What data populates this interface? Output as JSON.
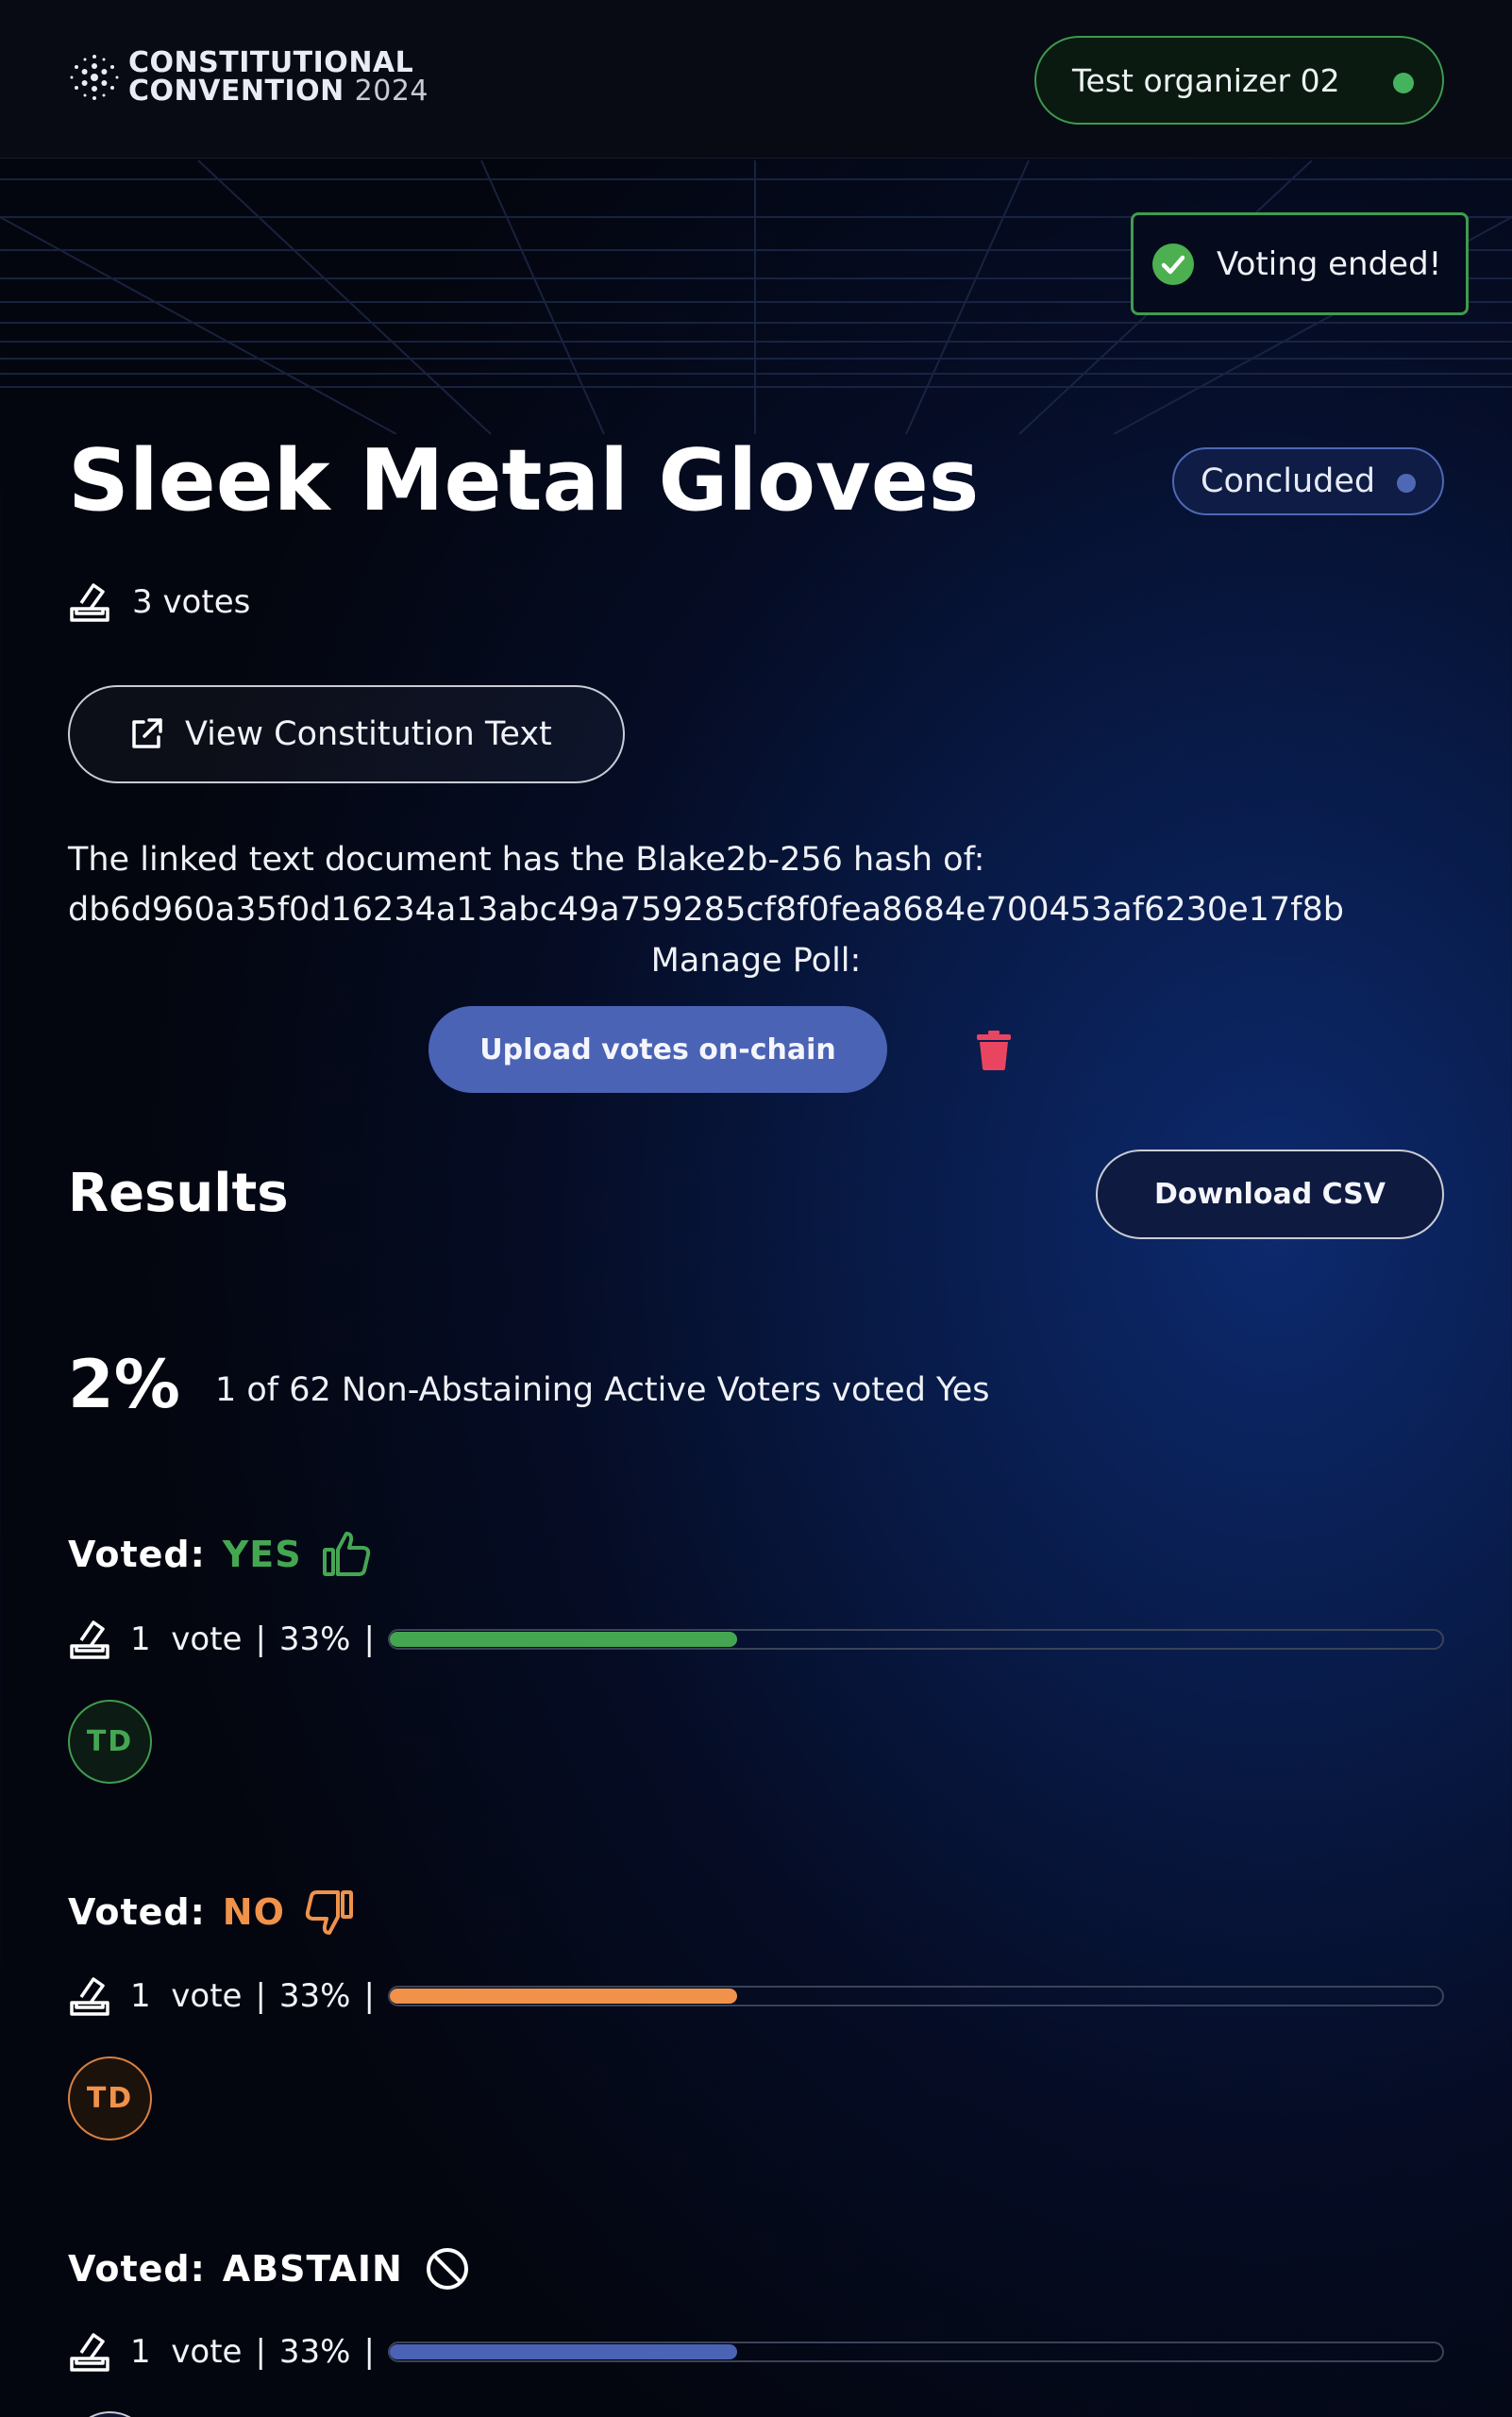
{
  "header": {
    "logo": {
      "line1": "CONSTITUTIONAL",
      "line2_main": "CONVENTION",
      "line2_year": "2024",
      "icon": "cardano-logo-icon"
    },
    "user": {
      "name": "Test organizer 02",
      "status_color": "#45b35d"
    }
  },
  "toast": {
    "icon": "check-circle-icon",
    "message": "Voting ended!"
  },
  "poll": {
    "title": "Sleek Metal Gloves",
    "status": "Concluded",
    "votes_total": "3 votes",
    "view_text_button": "View Constitution Text",
    "hash_label": "The linked text document has the Blake2b-256 hash of:",
    "hash_value": "db6d960a35f0d16234a13abc49a759285cf8f0fea8684e700453af6230e17f8b",
    "manage_label": "Manage Poll:",
    "upload_button": "Upload votes on-chain",
    "delete_icon": "trash-icon"
  },
  "results": {
    "title": "Results",
    "download_button": "Download CSV",
    "yes_percent": "2%",
    "summary": "1 of 62 Non-Abstaining Active Voters voted Yes",
    "groups": [
      {
        "label": "Voted:",
        "choice": "YES",
        "icon": "thumbs-up-icon",
        "color": "#45a652",
        "count": "1",
        "unit": "vote",
        "percent_text": "33%",
        "fraction": 0.33,
        "voters": [
          "TD"
        ]
      },
      {
        "label": "Voted:",
        "choice": "NO",
        "icon": "thumbs-down-icon",
        "color": "#f0924a",
        "count": "1",
        "unit": "vote",
        "percent_text": "33%",
        "fraction": 0.33,
        "voters": [
          "TD"
        ]
      },
      {
        "label": "Voted:",
        "choice": "ABSTAIN",
        "icon": "prohibited-icon",
        "color": "#4b63b5",
        "count": "1",
        "unit": "vote",
        "percent_text": "33%",
        "fraction": 0.33,
        "voters": []
      }
    ]
  }
}
